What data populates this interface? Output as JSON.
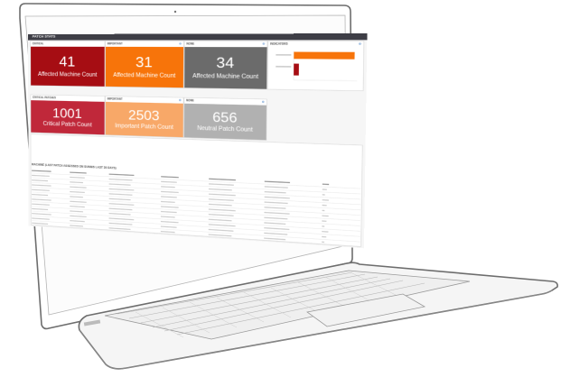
{
  "top_section": {
    "title": "PATCH STATS",
    "panels": [
      {
        "label": "CRITICAL",
        "value": "41",
        "caption": "Affected Machine Count",
        "color": "#a60d13"
      },
      {
        "label": "IMPORTANT",
        "value": "31",
        "caption": "Affected Machine Count",
        "color": "#f7740a"
      },
      {
        "label": "NONE",
        "value": "34",
        "caption": "Affected Machine Count",
        "color": "#6b6b6b"
      }
    ],
    "mini_chart": {
      "label": "INDICATORS"
    }
  },
  "bottom_section": {
    "panels": [
      {
        "label": "CRITICAL PATCHES",
        "value": "1001",
        "caption": "Critical Patch Count",
        "color": "#c0283a"
      },
      {
        "label": "IMPORTANT",
        "value": "2503",
        "caption": "Important Patch Count",
        "color": "#f8a868"
      },
      {
        "label": "NONE",
        "value": "656",
        "caption": "Neutral Patch Count",
        "color": "#b1b1b1"
      }
    ]
  },
  "table": {
    "title": "MACHINE (LAST PATCH ASSESSED ON SUNNIS LAST 30 DAYS)"
  },
  "colors": {
    "bezel": "#666666",
    "header": "#3e3e46"
  }
}
